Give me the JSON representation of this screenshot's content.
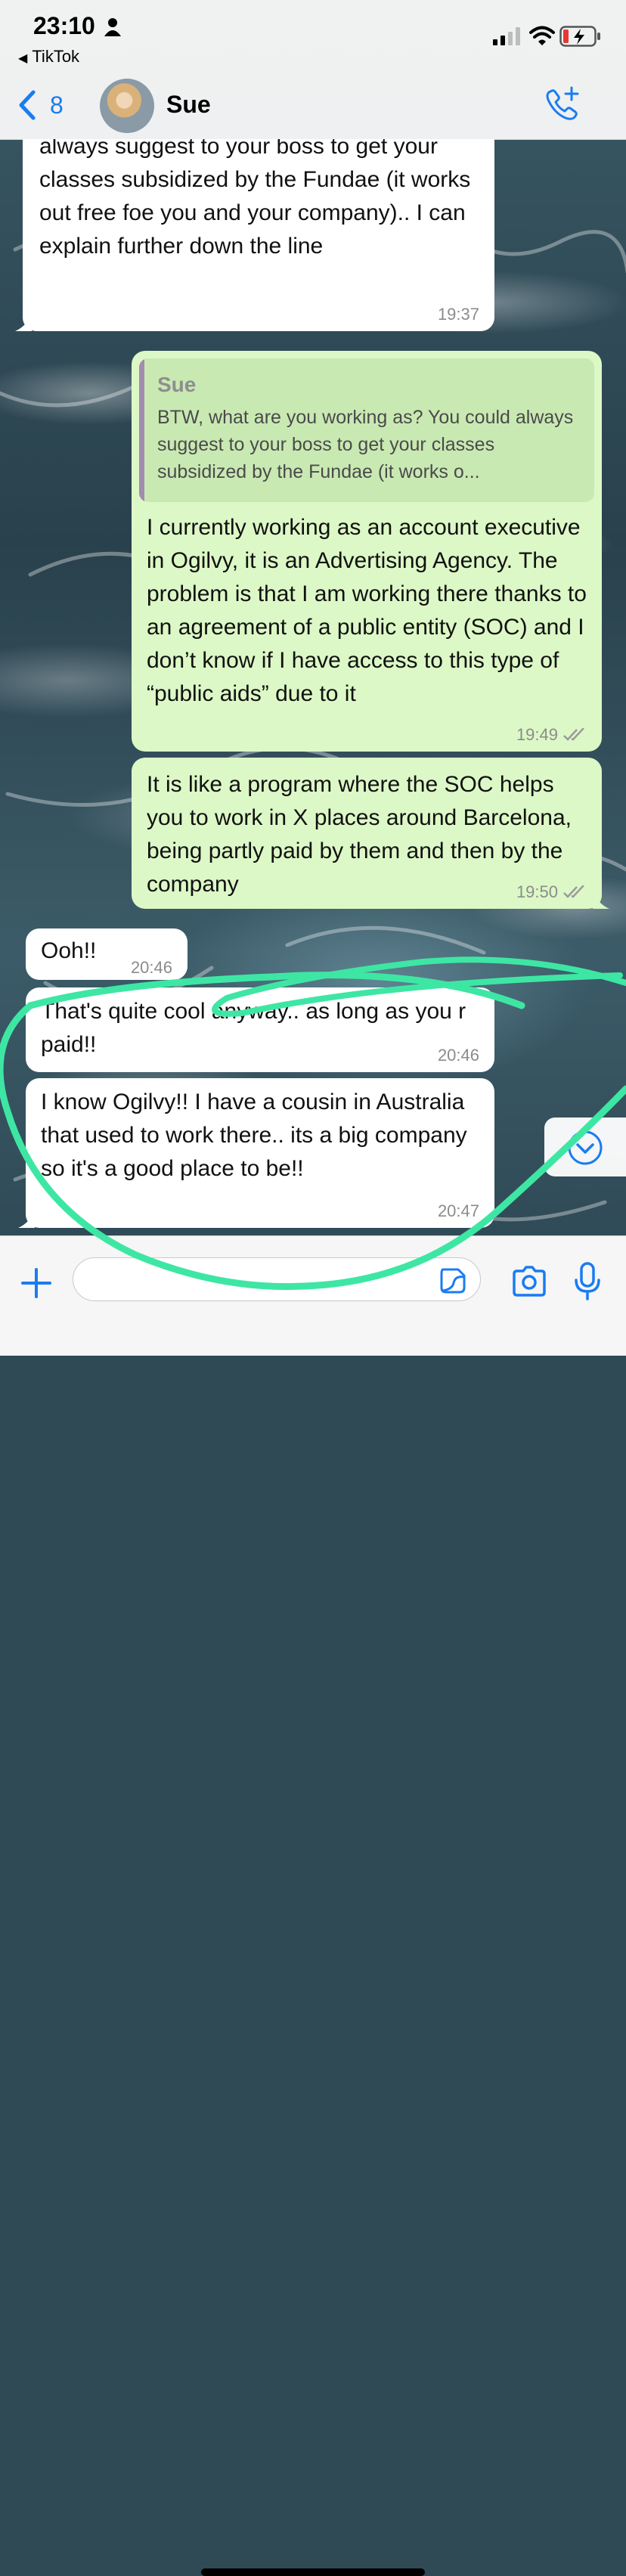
{
  "status_bar": {
    "time": "23:10",
    "back_app_label": "TikTok"
  },
  "header": {
    "unread_count": "8",
    "contact_name": "Sue"
  },
  "messages": [
    {
      "direction": "incoming",
      "text": "BTW, what are you working as? You could always suggest to your boss to get your classes subsidized by the Fundae (it works out free foe you and your company).. I can explain further down the line",
      "time": "19:37"
    },
    {
      "direction": "outgoing",
      "quote_author": "Sue",
      "quote_text": "BTW, what are you working as? You could always suggest to your boss to get your classes subsidized by the Fundae (it works o...",
      "text": "I currently working as an account executive in Ogilvy, it is an Advertising Agency. The problem is that I am working there thanks to an agreement of a public entity (SOC) and I don’t know if I have access to this type of “public aids” due to it",
      "time": "19:49"
    },
    {
      "direction": "outgoing",
      "text": "It is like a program where the SOC helps you to work in X places around Barcelona, being partly paid by them and then by the company",
      "time": "19:50"
    },
    {
      "direction": "incoming",
      "text": "Ooh!!",
      "time": "20:46"
    },
    {
      "direction": "incoming",
      "text": "That's quite cool anyway.. as long as you r paid!!",
      "time": "20:46"
    },
    {
      "direction": "incoming",
      "text": "I know Ogilvy!! I have a cousin in Australia that used to work there.. its a big  company so it's a good place to be!!",
      "time": "20:47"
    }
  ],
  "input": {
    "value": "",
    "placeholder": ""
  },
  "colors": {
    "accent": "#1a7cf0",
    "incoming_bubble": "#ffffff",
    "outgoing_bubble": "#dcf8c6",
    "highlight_scribble": "#3ee6a4"
  },
  "icons": [
    "person-icon",
    "signal-icon",
    "wifi-icon",
    "battery-charging-icon",
    "chevron-left-icon",
    "add-call-icon",
    "read-ticks-icon",
    "chevron-down-icon",
    "plus-icon",
    "sticker-icon",
    "camera-icon",
    "microphone-icon"
  ]
}
